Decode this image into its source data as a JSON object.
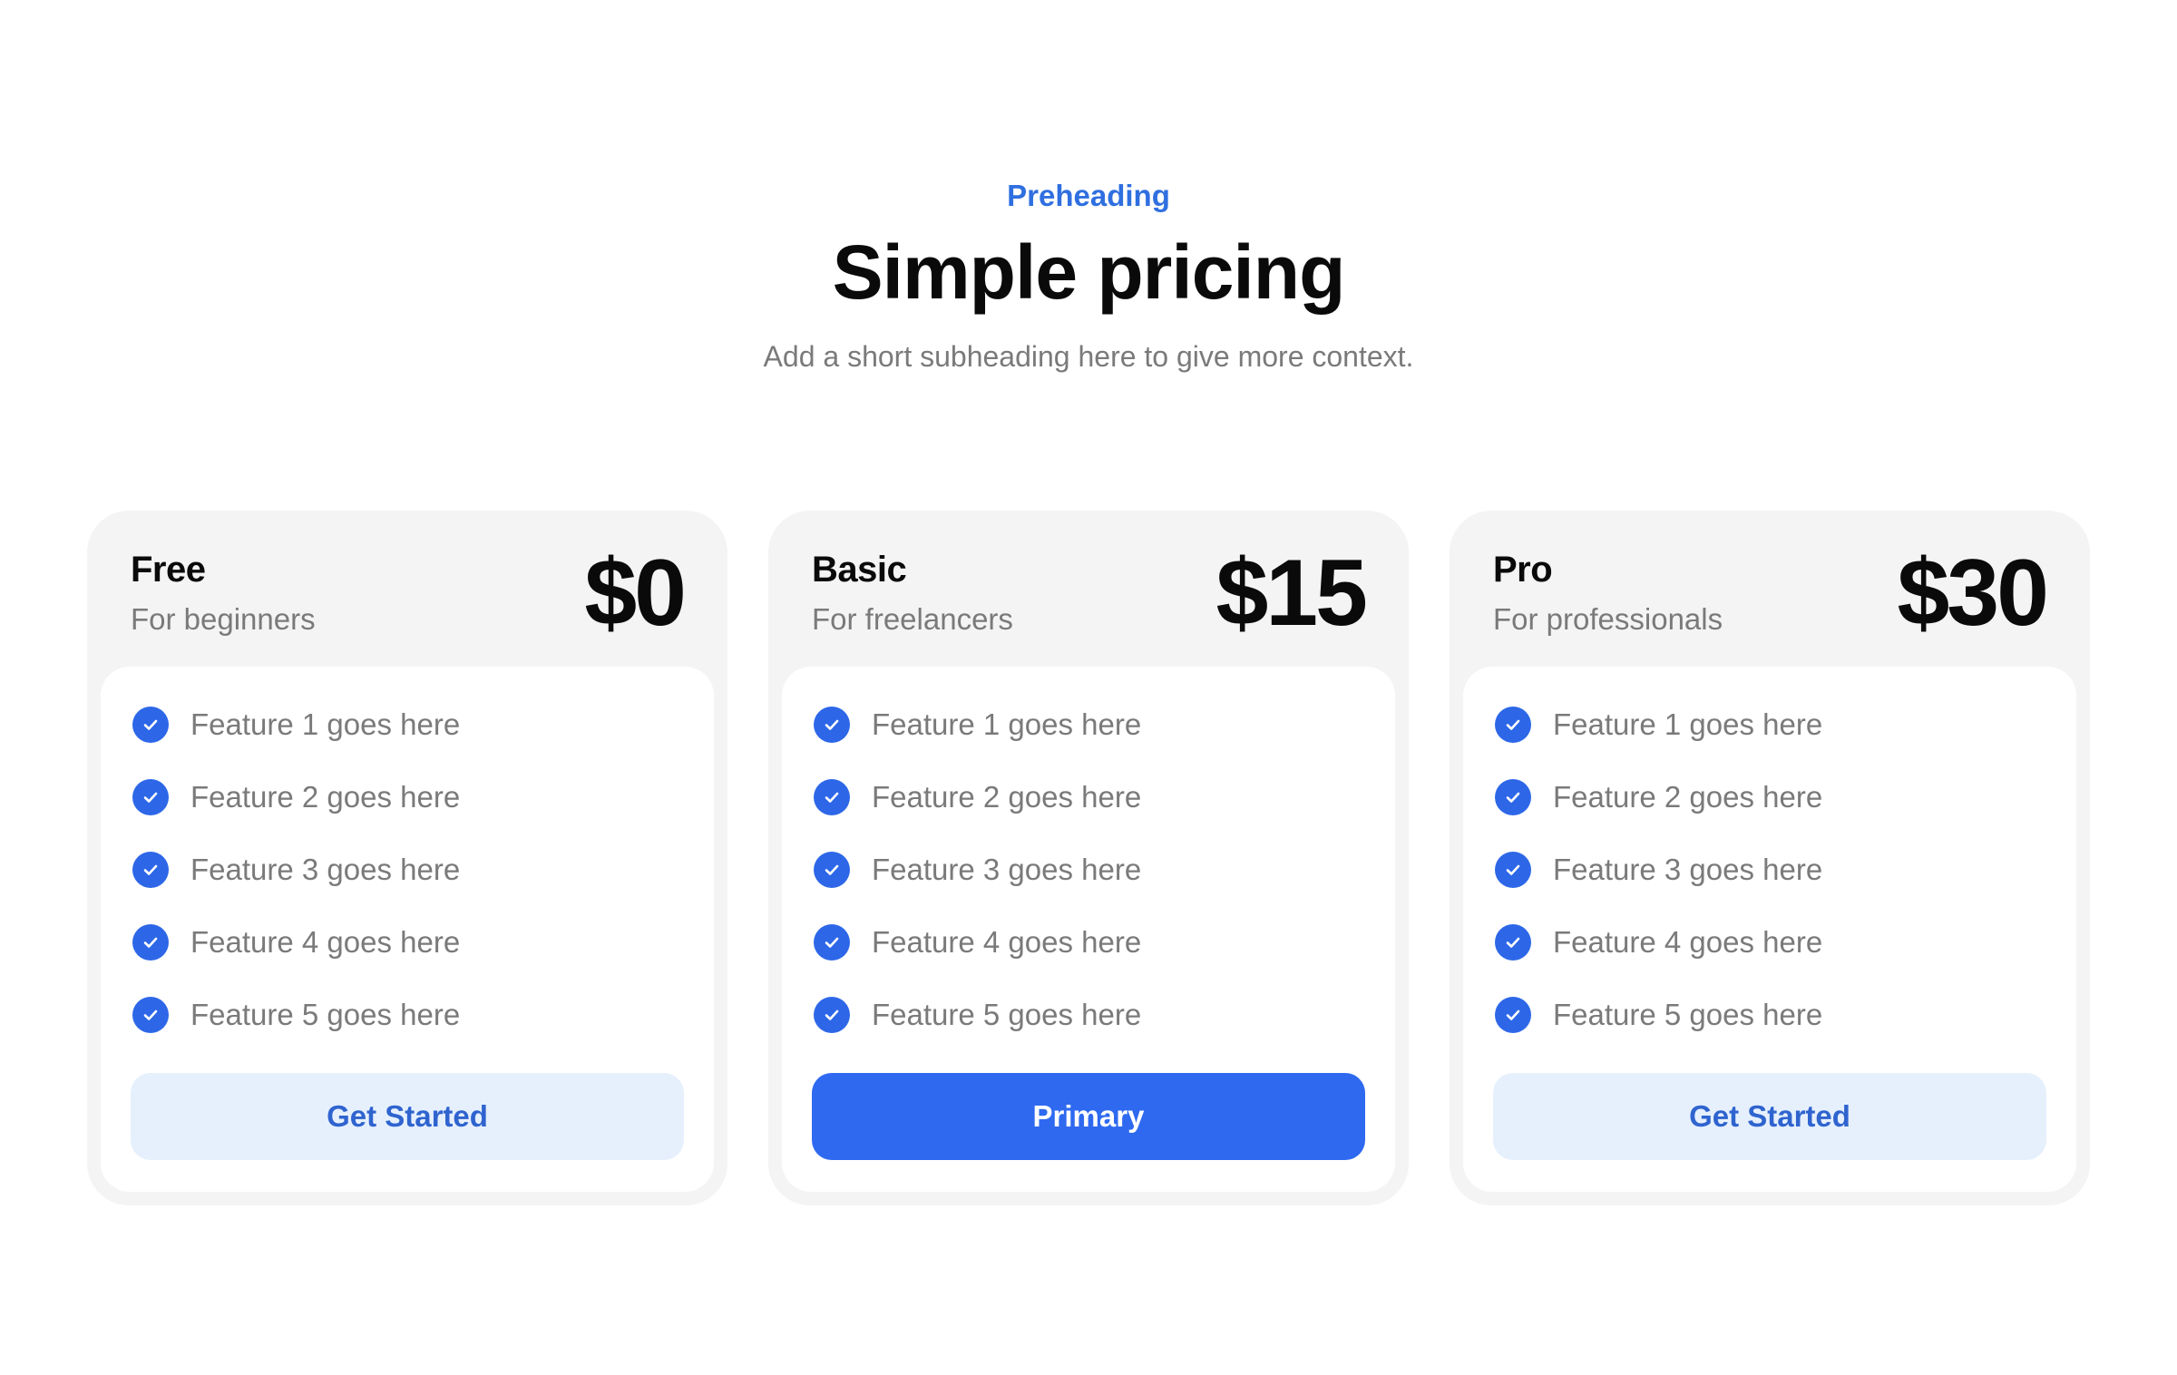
{
  "header": {
    "preheading": "Preheading",
    "title": "Simple pricing",
    "subheading": "Add a short subheading here to give more context."
  },
  "colors": {
    "accent": "#2f6fe0",
    "primary_button": "#2e69f0",
    "secondary_button_bg": "#e6f0fd",
    "card_bg": "#f4f4f5"
  },
  "plans": [
    {
      "name": "Free",
      "description": "For beginners",
      "price": "$0",
      "features": [
        "Feature 1 goes here",
        "Feature 2 goes here",
        "Feature 3 goes here",
        "Feature 4 goes here",
        "Feature 5 goes here"
      ],
      "button_label": "Get Started",
      "button_style": "secondary"
    },
    {
      "name": "Basic",
      "description": "For freelancers",
      "price": "$15",
      "features": [
        "Feature 1 goes here",
        "Feature 2 goes here",
        "Feature 3 goes here",
        "Feature 4 goes here",
        "Feature 5 goes here"
      ],
      "button_label": "Primary",
      "button_style": "primary"
    },
    {
      "name": "Pro",
      "description": "For professionals",
      "price": "$30",
      "features": [
        "Feature 1 goes here",
        "Feature 2 goes here",
        "Feature 3 goes here",
        "Feature 4 goes here",
        "Feature 5 goes here"
      ],
      "button_label": "Get Started",
      "button_style": "secondary"
    }
  ],
  "icons": {
    "feature_check": "check-circle-icon"
  }
}
